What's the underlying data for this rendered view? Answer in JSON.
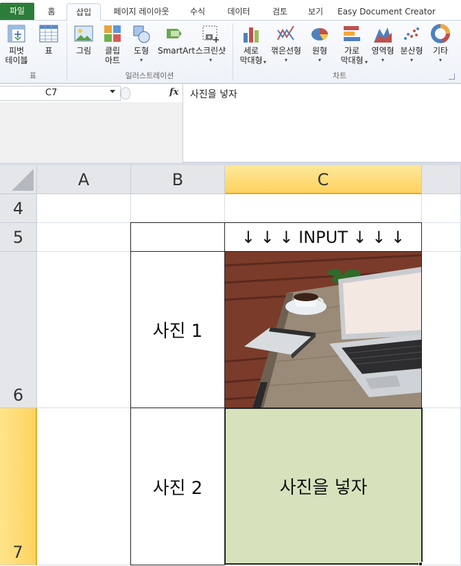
{
  "ribbon": {
    "tabs": [
      {
        "label": "파일"
      },
      {
        "label": "홈"
      },
      {
        "label": "삽입"
      },
      {
        "label": "페이지 레이아웃"
      },
      {
        "label": "수식"
      },
      {
        "label": "데이터"
      },
      {
        "label": "검토"
      },
      {
        "label": "보기"
      },
      {
        "label": "Easy Document Creator"
      }
    ],
    "active_tab": "삽입",
    "buttons": {
      "pivot": "피벗\n테이블",
      "table": "표",
      "picture": "그림",
      "clipart": "클립\n아트",
      "shapes": "도형",
      "smartart": "SmartArt",
      "screenshot": "스크린샷",
      "column": "세로\n막대형",
      "line": "꺾은선형",
      "pie": "원형",
      "bar": "가로\n막대형",
      "area": "영역형",
      "scatter": "분산형",
      "other": "기타"
    },
    "groups": {
      "tables": "표",
      "illustrations": "일러스트레이션",
      "charts": "차트"
    },
    "colors": {
      "file_tab": "#2d7d3a",
      "ribbon_bg": "#f4f6fa"
    }
  },
  "formula_bar": {
    "name_box": "C7",
    "fx_label": "fx",
    "content": "사진을 넣자"
  },
  "grid": {
    "columns": [
      "A",
      "B",
      "C"
    ],
    "selected_column": "C",
    "rows": [
      "4",
      "5",
      "6",
      "7"
    ],
    "selected_row": "7",
    "cells": {
      "C5": "↓ ↓ ↓ INPUT  ↓ ↓ ↓",
      "B6": "사진 1",
      "B7": "사진 2",
      "C7": "사진을 넣자"
    },
    "colors": {
      "header_bg": "#e4e6ea",
      "selected_header": "#fdd360",
      "input_fill": "#d6e2bc"
    }
  }
}
